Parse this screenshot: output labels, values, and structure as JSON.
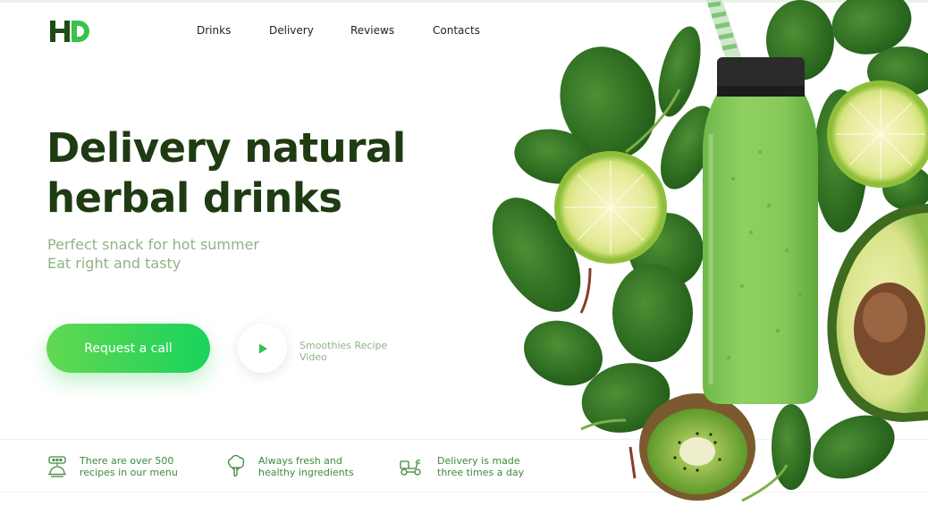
{
  "brand": {
    "logo_text": "HD"
  },
  "nav": {
    "items": [
      {
        "label": "Drinks"
      },
      {
        "label": "Delivery"
      },
      {
        "label": "Reviews"
      },
      {
        "label": "Contacts"
      }
    ]
  },
  "hero": {
    "title_line1": "Delivery natural",
    "title_line2": "herbal drinks",
    "subtitle_line1": "Perfect snack for hot summer",
    "subtitle_line2": "Eat right and tasty",
    "cta_label": "Request a call",
    "video_label_line1": "Smoothies Recipe",
    "video_label_line2": "Video"
  },
  "features": [
    {
      "icon": "recipes-icon",
      "line1": "There are over 500",
      "line2": "recipes in our menu"
    },
    {
      "icon": "broccoli-icon",
      "line1": "Always fresh and",
      "line2": "healthy ingredients"
    },
    {
      "icon": "delivery-scooter-icon",
      "line1": "Delivery is made",
      "line2": "three times a day"
    }
  ],
  "illustration": {
    "subject": "smoothie-bottle-with-limes-spinach-kiwi-avocado"
  },
  "colors": {
    "title": "#1e3b12",
    "subtitle": "#8fb386",
    "accent_start": "#62d851",
    "accent_end": "#19d35c",
    "feature_text": "#3d8a3a"
  }
}
